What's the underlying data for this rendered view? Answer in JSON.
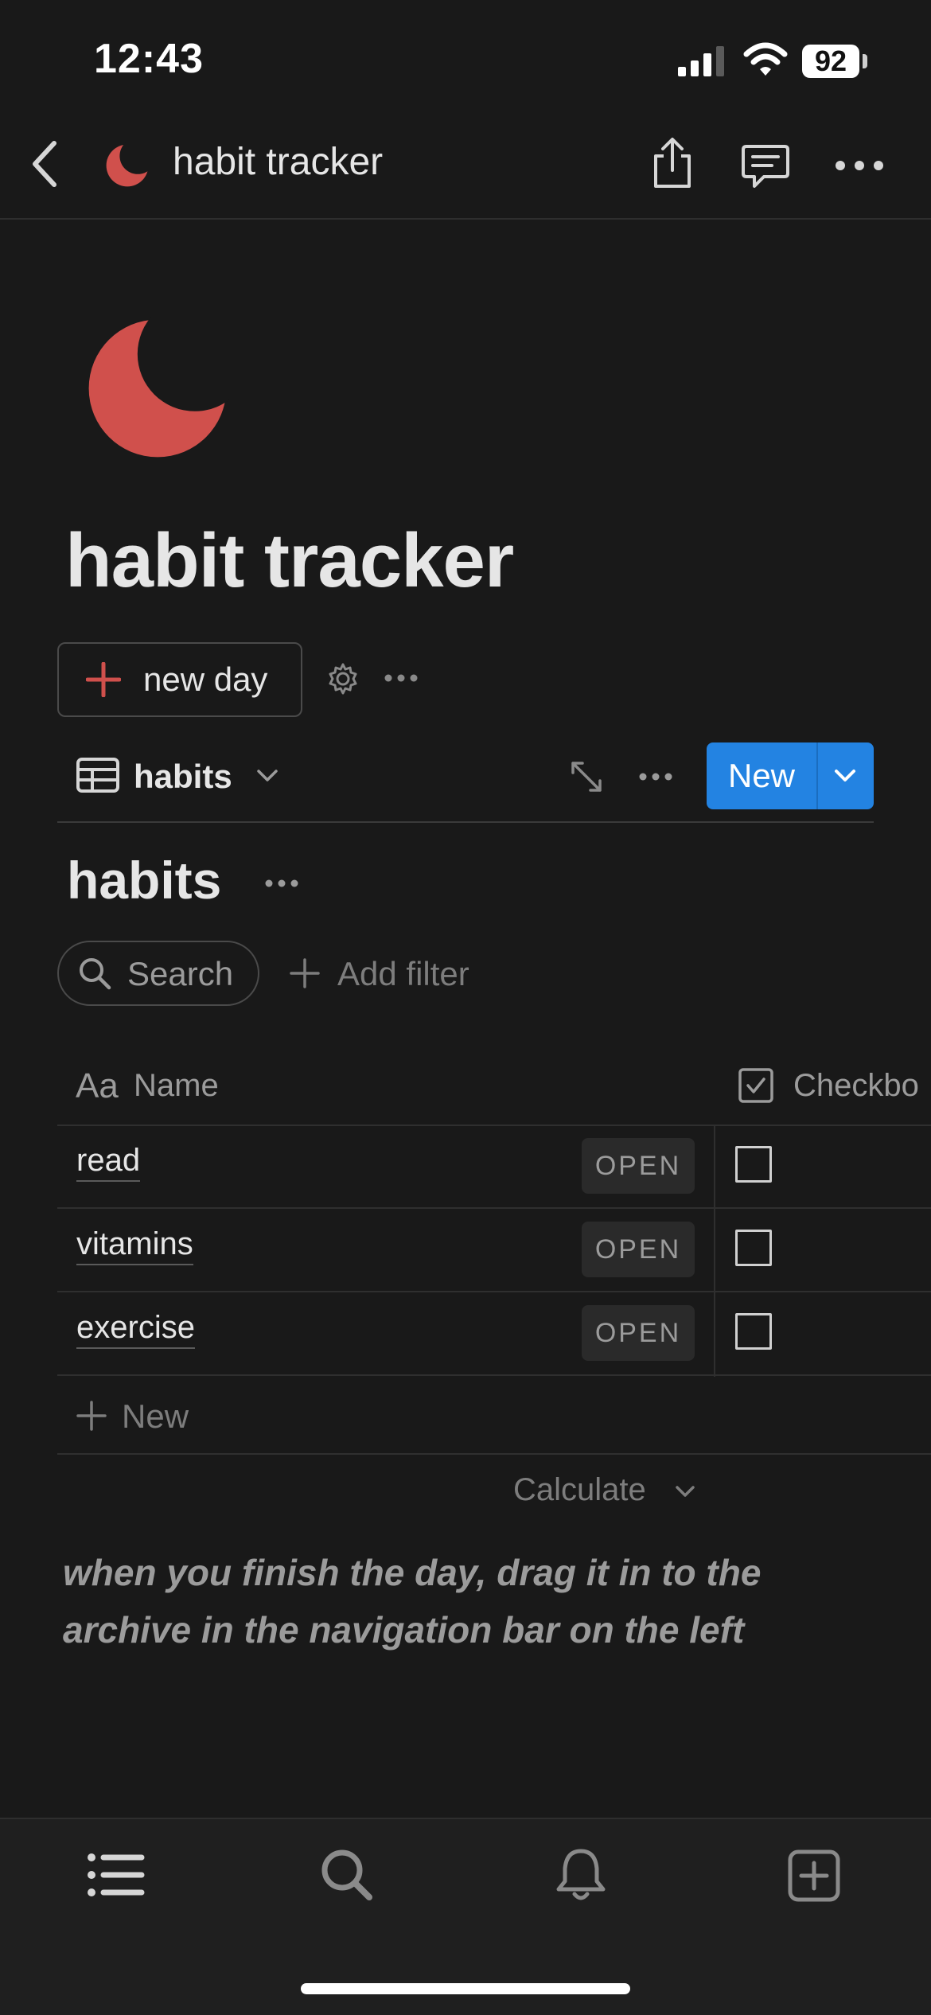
{
  "status_bar": {
    "time": "12:43",
    "battery": "92"
  },
  "nav": {
    "title": "habit tracker"
  },
  "page": {
    "title": "habit tracker"
  },
  "actions": {
    "new_day_label": "new day"
  },
  "view": {
    "label": "habits",
    "new_button_label": "New"
  },
  "database": {
    "title": "habits",
    "search_label": "Search",
    "add_filter_label": "Add filter",
    "columns": {
      "name_prefix": "Aa",
      "name": "Name",
      "checkbox": "Checkbo"
    },
    "rows": [
      {
        "name": "read",
        "open_label": "OPEN",
        "checked": false
      },
      {
        "name": "vitamins",
        "open_label": "OPEN",
        "checked": false
      },
      {
        "name": "exercise",
        "open_label": "OPEN",
        "checked": false
      }
    ],
    "add_new_label": "New",
    "calculate_label": "Calculate"
  },
  "note": "when you finish the day, drag it in to the archive in the navigation bar on the left",
  "colors": {
    "accent_red": "#d0504c",
    "primary_blue": "#2383e2",
    "background": "#191919"
  }
}
